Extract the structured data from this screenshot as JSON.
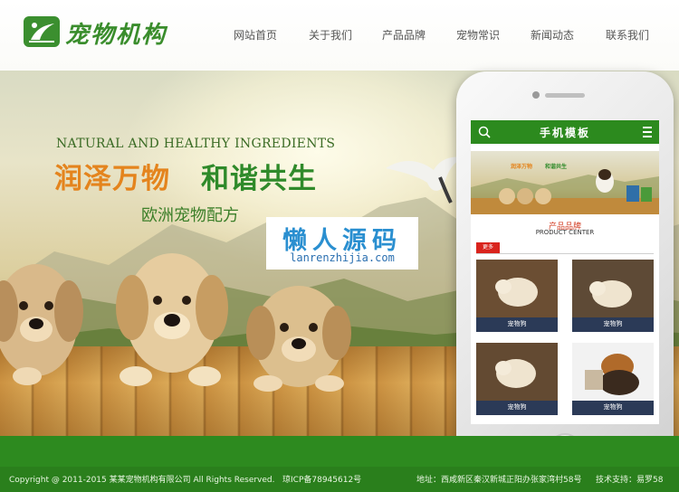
{
  "site": {
    "logo_text": "宠物机构"
  },
  "nav": {
    "items": [
      "网站首页",
      "关于我们",
      "产品品牌",
      "宠物常识",
      "新闻动态",
      "联系我们"
    ]
  },
  "hero": {
    "english_line": "NATURAL AND HEALTHY INGREDIENTS",
    "cn_line_1": "润泽万物",
    "cn_line_2": "和谐共生",
    "subtitle": "欧洲宠物配方"
  },
  "watermark": {
    "title": "懒人源码",
    "url": "lanrenzhijia.com"
  },
  "mobile": {
    "title": "手机模板",
    "banner_text_1": "润泽万物",
    "banner_text_2": "和谐共生",
    "section_title": "产品品牌",
    "section_subtitle": "PRODUCT CENTER",
    "more_label": "更多",
    "products": [
      {
        "label": "宠物狗"
      },
      {
        "label": "宠物狗"
      },
      {
        "label": "宠物狗"
      },
      {
        "label": "宠物狗"
      }
    ]
  },
  "footer": {
    "copyright": "Copyright @ 2011-2015 某某宠物机构有限公司 All Rights Reserved.",
    "icp": "琼ICP备78945612号",
    "address": "地址：西咸新区秦汉新城正阳办张家湾村58号",
    "support": "技术支持：易罗58"
  },
  "colors": {
    "brand_green": "#2d8a1f",
    "accent_orange": "#e4841d",
    "watermark_blue": "#2a8fd0"
  }
}
